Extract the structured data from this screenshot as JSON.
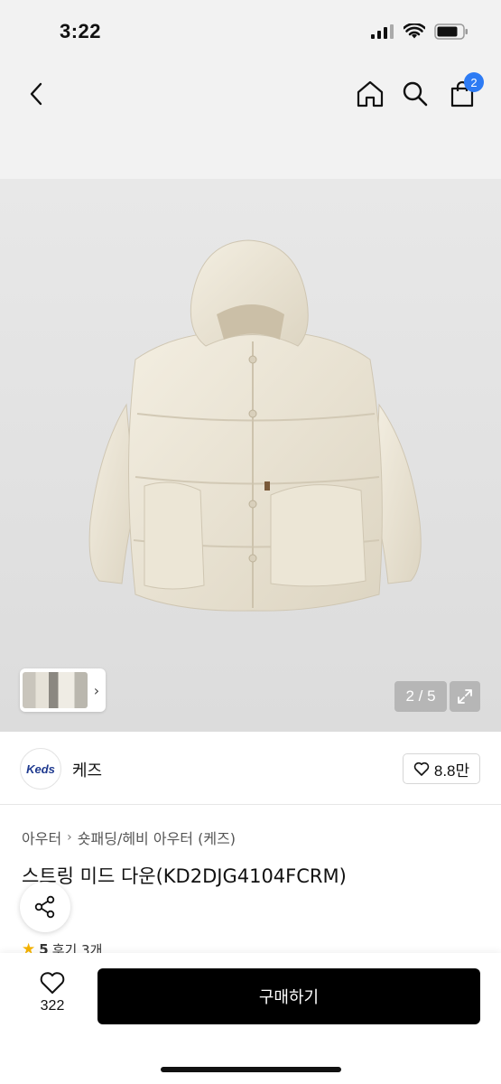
{
  "status_bar": {
    "time": "3:22"
  },
  "nav": {
    "cart_count": "2"
  },
  "gallery": {
    "counter": "2 / 5"
  },
  "brand": {
    "logo_text": "Keds",
    "name": "케즈",
    "likes": "8.8만"
  },
  "breadcrumb": {
    "level1": "아우터",
    "level2": "숏패딩/헤비 아우터 (케즈)"
  },
  "product": {
    "title": "스트링 미드 다운(KD2DJG4104FCRM)"
  },
  "rating": {
    "score": "5",
    "reviews": "후기 3개"
  },
  "bottom_bar": {
    "wish_count": "322",
    "buy_label": "구매하기"
  },
  "colors": {
    "badge": "#2d7bf4",
    "buy_button": "#000000",
    "star": "#f5b301"
  }
}
